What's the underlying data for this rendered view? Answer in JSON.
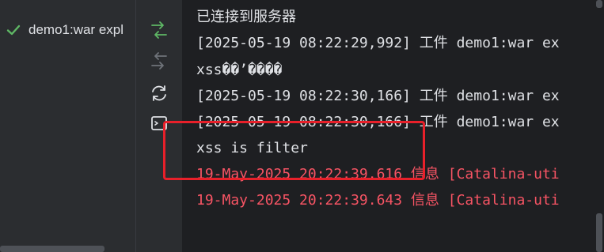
{
  "services_tree": {
    "artifact_label": "demo1:war expl",
    "status_icon": "check-icon"
  },
  "toolbar": {
    "icons": [
      "deploy-icon",
      "undeploy-icon",
      "refresh-icon",
      "console-icon"
    ]
  },
  "console": {
    "lines": [
      {
        "text": "已连接到服务器",
        "color": "#dfe1e5"
      },
      {
        "text": "[2025-05-19 08:22:29,992] 工件 demo1:war ex",
        "color": "#dfe1e5"
      },
      {
        "text": "xss��’����",
        "color": "#dfe1e5"
      },
      {
        "text": "[2025-05-19 08:22:30,166] 工件 demo1:war ex",
        "color": "#dfe1e5"
      },
      {
        "text": "[2025-05-19 08:22:30,166] 工件 demo1:war ex",
        "color": "#dfe1e5"
      },
      {
        "text": "xss is filter",
        "color": "#dfe1e5"
      },
      {
        "text": "19-May-2025 20:22:39.616 信息 [Catalina-uti",
        "color": "#f75464"
      },
      {
        "text": "19-May-2025 20:22:39.643 信息 [Catalina-uti",
        "color": "#f75464"
      }
    ]
  },
  "colors": {
    "highlight_box": "#e8202a",
    "error_text": "#f75464",
    "normal_text": "#dfe1e5"
  }
}
